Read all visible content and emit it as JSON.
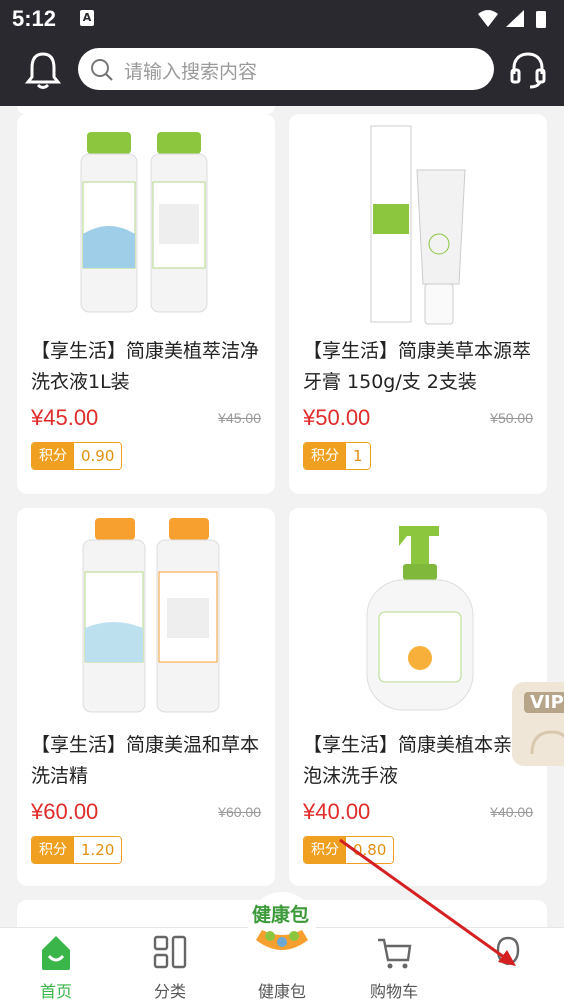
{
  "status_bar": {
    "time": "5:12",
    "notif_glyph": "A"
  },
  "header": {
    "search_placeholder": "请输入搜索内容"
  },
  "products": [
    {
      "title": "【享生活】简康美植萃洁净洗衣液1L装",
      "price": "¥45.00",
      "original_price": "¥45.00",
      "points_label": "积分",
      "points": "0.90"
    },
    {
      "title": "【享生活】简康美草本源萃牙膏 150g/支 2支装",
      "price": "¥50.00",
      "original_price": "¥50.00",
      "points_label": "积分",
      "points": "1"
    },
    {
      "title": "【享生活】简康美温和草本洗洁精",
      "price": "¥60.00",
      "original_price": "¥60.00",
      "points_label": "积分",
      "points": "1.20"
    },
    {
      "title": "【享生活】简康美植本亲肤泡沫洗手液",
      "price": "¥40.00",
      "original_price": "¥40.00",
      "points_label": "积分",
      "points": "0.80"
    }
  ],
  "vip_badge": "VIP",
  "tabbar": {
    "tabs": [
      {
        "label": "首页"
      },
      {
        "label": "分类"
      },
      {
        "label": "健康包"
      },
      {
        "label": "购物车"
      },
      {
        "label": ""
      }
    ],
    "health_bag_logo_text": "健康包"
  },
  "colors": {
    "accent": "#39b54a",
    "price": "#e02b2b",
    "points": "#f0a020",
    "header_bg": "#2b2930"
  }
}
